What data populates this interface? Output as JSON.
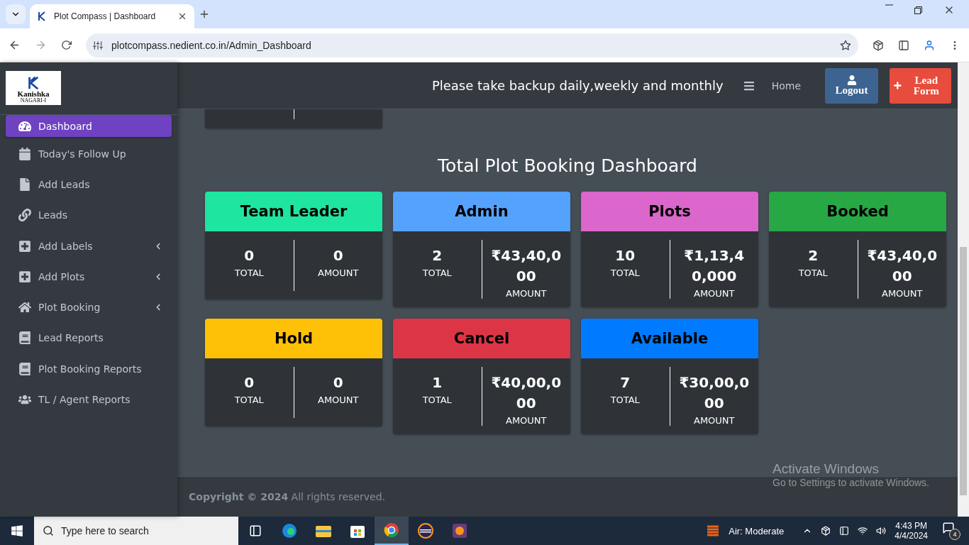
{
  "browser": {
    "tab_title": "Plot Compass | Dashboard",
    "url": "plotcompass.nedient.co.in/Admin_Dashboard"
  },
  "sidebar": {
    "logo_text": "Kanishka",
    "logo_subtext": "NAGARI-I",
    "items": [
      {
        "label": "Dashboard",
        "selected": true,
        "submenu": false
      },
      {
        "label": "Today's Follow Up",
        "selected": false,
        "submenu": false
      },
      {
        "label": "Add Leads",
        "selected": false,
        "submenu": false
      },
      {
        "label": "Leads",
        "selected": false,
        "submenu": false
      },
      {
        "label": "Add Labels",
        "selected": false,
        "submenu": true
      },
      {
        "label": "Add Plots",
        "selected": false,
        "submenu": true
      },
      {
        "label": "Plot Booking",
        "selected": false,
        "submenu": true
      },
      {
        "label": "Lead Reports",
        "selected": false,
        "submenu": false
      },
      {
        "label": "Plot Booking Reports",
        "selected": false,
        "submenu": false
      },
      {
        "label": "TL / Agent Reports",
        "selected": false,
        "submenu": false
      }
    ]
  },
  "header": {
    "notice": "Please take backup daily,weekly and monthly",
    "home": "Home",
    "logout": "Logout",
    "lead_form": "Lead Form"
  },
  "dashboard": {
    "title": "Total Plot Booking Dashboard",
    "cards": [
      {
        "title": "Team Leader",
        "color": "#1ee5a0",
        "total": "0",
        "total_label": "TOTAL",
        "amount": "0",
        "amount_label": "AMOUNT"
      },
      {
        "title": "Admin",
        "color": "#55a2fc",
        "total": "2",
        "total_label": "TOTAL",
        "amount": "₹43,40,000",
        "amount_label": "AMOUNT"
      },
      {
        "title": "Plots",
        "color": "#db66cc",
        "total": "10",
        "total_label": "TOTAL",
        "amount": "₹1,13,40,000",
        "amount_label": "AMOUNT"
      },
      {
        "title": "Booked",
        "color": "#28a745",
        "total": "2",
        "total_label": "TOTAL",
        "amount": "₹43,40,000",
        "amount_label": "AMOUNT"
      },
      {
        "title": "Hold",
        "color": "#ffc107",
        "total": "0",
        "total_label": "TOTAL",
        "amount": "0",
        "amount_label": "AMOUNT"
      },
      {
        "title": "Cancel",
        "color": "#dc3545",
        "total": "1",
        "total_label": "TOTAL",
        "amount": "₹40,00,000",
        "amount_label": "AMOUNT"
      },
      {
        "title": "Available",
        "color": "#007bff",
        "total": "7",
        "total_label": "TOTAL",
        "amount": "₹30,00,000",
        "amount_label": "AMOUNT"
      }
    ]
  },
  "footer": "**Copyright © 2024** All rights reserved.",
  "activation": {
    "title": "Activate Windows",
    "text": "Go to Settings to activate Windows."
  },
  "taskbar": {
    "search_placeholder": "Type here to search",
    "weather": "Air: Moderate",
    "time": "4:43 PM",
    "date": "4/4/2024",
    "notifications": "4"
  }
}
